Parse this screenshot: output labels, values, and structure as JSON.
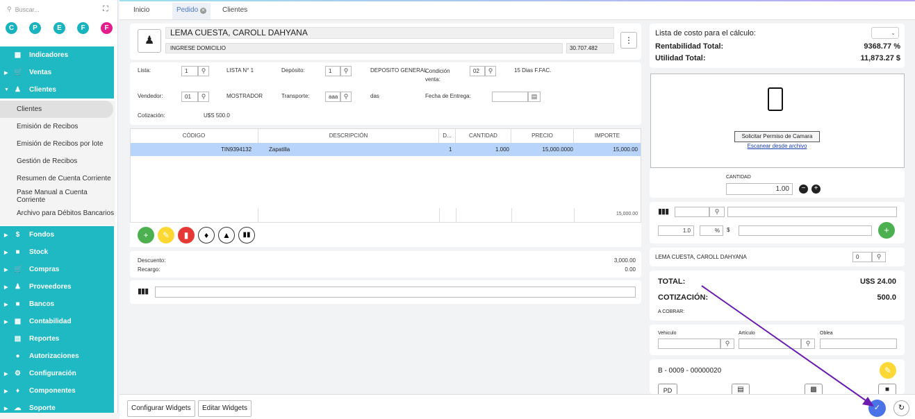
{
  "sidebar": {
    "search_placeholder": "Buscar...",
    "letters": [
      "C",
      "P",
      "E",
      "F",
      "F"
    ],
    "nav_top": [
      {
        "icon": "chart-icon",
        "label": "Indicadores"
      },
      {
        "icon": "cart-icon",
        "label": "Ventas"
      },
      {
        "icon": "people-icon",
        "label": "Clientes"
      }
    ],
    "submenu": [
      "Clientes",
      "Emisión de Recibos",
      "Emisión de Recibos por lote",
      "Gestión de Recibos",
      "Resumen de Cuenta Corriente",
      "Pase Manual a Cuenta Corriente",
      "Archivo para Débitos Bancarios"
    ],
    "nav_bottom": [
      {
        "icon": "dollar-icon",
        "label": "Fondos"
      },
      {
        "icon": "box-icon",
        "label": "Stock"
      },
      {
        "icon": "cart-icon",
        "label": "Compras"
      },
      {
        "icon": "people-icon",
        "label": "Proveedores"
      },
      {
        "icon": "bank-icon",
        "label": "Bancos"
      },
      {
        "icon": "book-icon",
        "label": "Contabilidad"
      },
      {
        "icon": "report-icon",
        "label": "Reportes"
      },
      {
        "icon": "lock-icon",
        "label": "Autorizaciones"
      },
      {
        "icon": "gear-icon",
        "label": "Configuración"
      },
      {
        "icon": "tag-icon",
        "label": "Componentes"
      },
      {
        "icon": "cloud-icon",
        "label": "Soporte"
      }
    ]
  },
  "tabs": [
    "Inicio",
    "Pedido",
    "Clientes"
  ],
  "client": {
    "name": "LEMA CUESTA, CAROLL DAHYANA",
    "address": "INGRESE DOMICILIO",
    "code": "30.707.482"
  },
  "form": {
    "lista_label": "Lista:",
    "lista_val": "1",
    "lista_name": "LISTA N° 1",
    "deposito_label": "Depósito:",
    "deposito_val": "1",
    "deposito_name": "DEPOSITO GENERAL",
    "condicion_label": "Condición venta:",
    "condicion_val": "02",
    "condicion_name": "15 Dias F.FAC.",
    "vendedor_label": "Vendedor:",
    "vendedor_val": "01",
    "vendedor_name": "MOSTRADOR",
    "transporte_label": "Transporte:",
    "transporte_val": "aaa",
    "transporte_name": "das",
    "entrega_label": "Fecha de Entrega:",
    "cotizacion_label": "Cotización:",
    "cotizacion_val": "U$S 500.0"
  },
  "table": {
    "headers": [
      "CÓDIGO",
      "DESCRIPCIÓN",
      "D...",
      "CANTIDAD",
      "PRECIO",
      "IMPORTE"
    ],
    "rows": [
      {
        "codigo": "TIN9394132",
        "descripcion": "Zapatilla",
        "d": "1",
        "cantidad": "1.000",
        "precio": "15,000.0000",
        "importe": "15,000.00"
      }
    ],
    "footer_total": "15,000.00"
  },
  "discounts": {
    "descuento_label": "Descuento:",
    "descuento_val": "3,000.00",
    "recargo_label": "Recargo:",
    "recargo_val": "0.00"
  },
  "right": {
    "costo_label": "Lista de costo para el cálculo:",
    "rent_label": "Rentabilidad Total:",
    "rent_val": "9368.77 %",
    "util_label": "Utilidad Total:",
    "util_val": "11,873.27 $",
    "camera_btn": "Solicitar Permiso de Camara",
    "scan_link": "Escanear desde archivo",
    "cantidad_label": "CANTIDAD",
    "cantidad_val": "1.00",
    "qty2": "1.0",
    "pct": "%",
    "dollar": "$",
    "client_name": "LEMA CUESTA, CAROLL DAHYANA",
    "client_num": "0",
    "total_label": "TOTAL:",
    "total_val": "U$S 24.00",
    "cot_label": "COTIZACIÓN:",
    "cot_val": "500.0",
    "cobrar_label": "A COBRAR:",
    "vehiculo": "Vehiculo",
    "articulo": "Artículo",
    "oblea": "Oblea",
    "comp_num": "B - 0009 - 00000020",
    "pd": "PD"
  },
  "bottom": {
    "config": "Configurar Widgets",
    "edit": "Editar Widgets"
  },
  "colors": {
    "teal": "#1fb9c3",
    "green": "#4caf50",
    "yellow": "#fdd835",
    "red": "#e53935",
    "blue": "#4a73e8",
    "highlight": "#b8d4fb",
    "arrow": "#6a1bb0"
  }
}
